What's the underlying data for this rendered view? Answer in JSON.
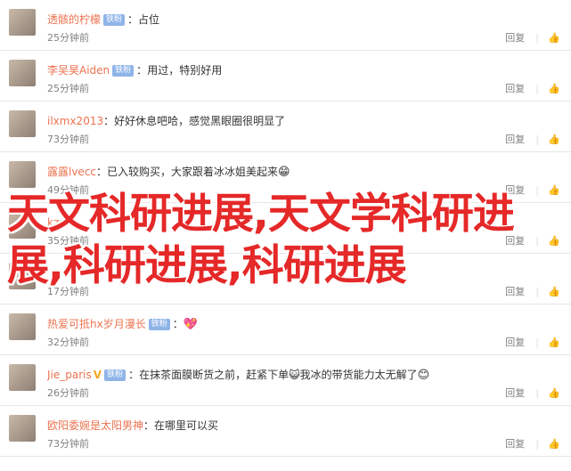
{
  "comments": [
    {
      "user": "透骸的柠檬",
      "badge": "铁粉",
      "vip": false,
      "text": "占位",
      "emoji": "",
      "time": "25分钟前",
      "reply": "回复",
      "likes": ""
    },
    {
      "user": "李吴昊Aiden",
      "badge": "铁粉",
      "vip": false,
      "text": "用过，特别好用",
      "emoji": "",
      "time": "25分钟前",
      "reply": "回复",
      "likes": ""
    },
    {
      "user": "ilxmx2013",
      "badge": "",
      "vip": false,
      "text": "好好休息吧哈，感觉黑眼圈很明显了",
      "emoji": "",
      "time": "73分钟前",
      "reply": "回复",
      "likes": ""
    },
    {
      "user": "露露lvecc",
      "badge": "",
      "vip": false,
      "text": "已入较购买，大家跟着冰冰姐美起来",
      "emoji": "😁",
      "time": "49分钟前",
      "reply": "回复",
      "likes": ""
    },
    {
      "user": "kzx",
      "badge": "",
      "vip": false,
      "text": "",
      "emoji": "",
      "time": "35分钟前",
      "reply": "回复",
      "likes": ""
    },
    {
      "user": "",
      "badge": "",
      "vip": false,
      "text": "",
      "emoji": "",
      "time": "17分钟前",
      "reply": "回复",
      "likes": ""
    },
    {
      "user": "热爱可抵hx岁月漫长",
      "badge": "铁粉",
      "vip": false,
      "text": "",
      "emoji": "💖",
      "time": "32分钟前",
      "reply": "回复",
      "likes": ""
    },
    {
      "user": "Jie_paris",
      "badge": "铁粉",
      "vip": true,
      "text": "在抹茶面膜断货之前，赶紧下单😺我冰的带货能力太无解了",
      "emoji": "😊",
      "time": "26分钟前",
      "reply": "回复",
      "likes": ""
    },
    {
      "user": "欧阳委婉是太阳男神",
      "badge": "",
      "vip": false,
      "text": "在哪里可以买",
      "emoji": "",
      "time": "73分钟前",
      "reply": "回复",
      "likes": ""
    }
  ],
  "overlay_title": "天文科研进展,天文学科研进展,科研进展,科研进展",
  "colors": {
    "username": "#eb7350",
    "overlay": "#e52828",
    "badge": "#8fb4e8"
  },
  "icons": {
    "like": "thumbs-up-icon"
  }
}
